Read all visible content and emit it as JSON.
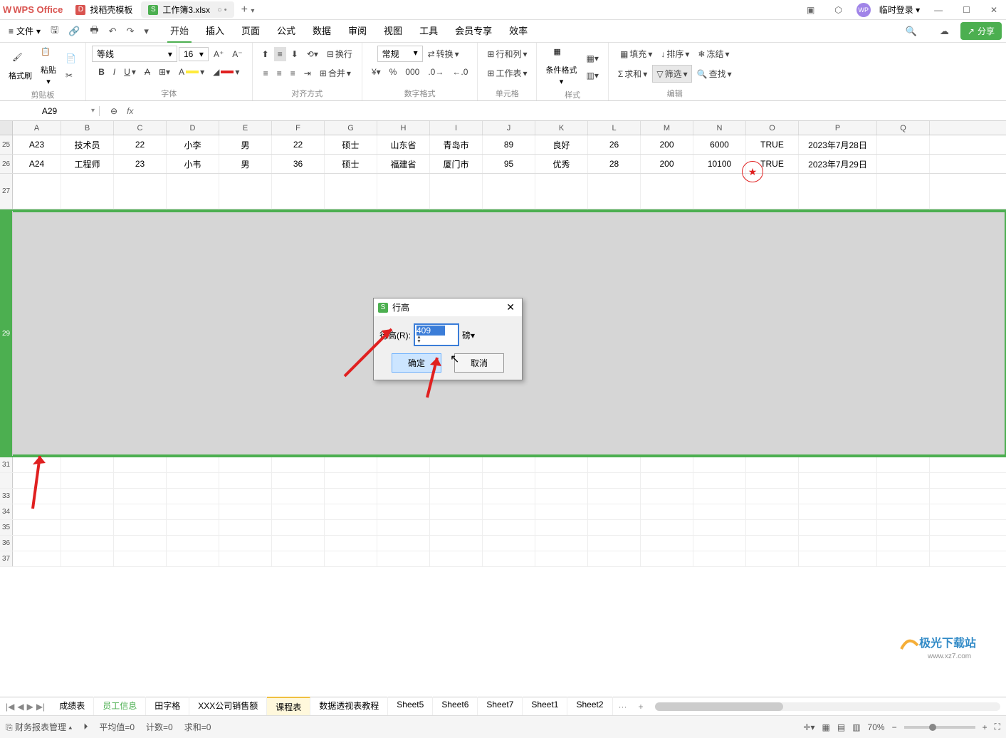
{
  "titlebar": {
    "app_name": "WPS Office",
    "tabs": [
      {
        "label": "找稻壳模板",
        "icon_color": "red"
      },
      {
        "label": "工作簿3.xlsx",
        "icon_color": "green",
        "active": true,
        "extra": "○ •"
      }
    ],
    "login_label": "临时登录",
    "add_glyph": "+",
    "dd_glyph": "▾"
  },
  "menubar": {
    "file_label": "文件",
    "tabs": [
      "开始",
      "插入",
      "页面",
      "公式",
      "数据",
      "审阅",
      "视图",
      "工具",
      "会员专享",
      "效率"
    ],
    "active_tab": "开始",
    "share_label": "分享"
  },
  "ribbon": {
    "clipboard": {
      "brush": "格式刷",
      "paste": "粘贴",
      "group": "剪贴板"
    },
    "font": {
      "name": "等线",
      "size": "16",
      "group": "字体"
    },
    "align": {
      "wrap": "换行",
      "merge": "合并",
      "group": "对齐方式"
    },
    "number": {
      "format": "常规",
      "convert": "转换",
      "group": "数字格式"
    },
    "cells": {
      "rowcol": "行和列",
      "worksheet": "工作表",
      "group": "单元格"
    },
    "styles": {
      "condfmt": "条件格式",
      "group": "样式"
    },
    "edit": {
      "fill": "填充",
      "sort": "排序",
      "freeze": "冻结",
      "sum": "求和",
      "filter": "筛选",
      "find": "查找",
      "group": "编辑"
    }
  },
  "formula_bar": {
    "namebox": "A29",
    "fx": "fx"
  },
  "columns": [
    "A",
    "B",
    "C",
    "D",
    "E",
    "F",
    "G",
    "H",
    "I",
    "J",
    "K",
    "L",
    "M",
    "N",
    "O",
    "P",
    "Q"
  ],
  "col_classes": [
    "cw-a",
    "cw-b",
    "cw-c",
    "cw-d",
    "cw-e",
    "cw-f",
    "cw-g",
    "cw-h",
    "cw-i",
    "cw-j",
    "cw-k",
    "cw-l",
    "cw-m",
    "cw-n",
    "cw-o",
    "cw-p",
    "cw-q"
  ],
  "rows_visible_labels": [
    "25",
    "26",
    "27",
    "",
    "29",
    "",
    "31",
    "",
    "33",
    "34",
    "35",
    "36",
    "37"
  ],
  "data_rows": [
    {
      "n": "25",
      "cells": [
        "A23",
        "技术员",
        "22",
        "小李",
        "男",
        "22",
        "硕士",
        "山东省",
        "青岛市",
        "89",
        "良好",
        "26",
        "200",
        "6000",
        "TRUE",
        "2023年7月28日",
        ""
      ]
    },
    {
      "n": "26",
      "cells": [
        "A24",
        "工程师",
        "23",
        "小韦",
        "男",
        "36",
        "硕士",
        "福建省",
        "厦门市",
        "95",
        "优秀",
        "28",
        "200",
        "10100",
        "TRUE",
        "2023年7月29日",
        ""
      ]
    }
  ],
  "dialog": {
    "title": "行高",
    "label": "行高(R):",
    "value": "409",
    "unit": "磅",
    "ok": "确定",
    "cancel": "取消"
  },
  "sheet_tabs": {
    "nav": [
      "|◀",
      "◀",
      "▶",
      "▶|"
    ],
    "tabs": [
      "成绩表",
      "员工信息",
      "田字格",
      "XXX公司销售额",
      "课程表",
      "数据透视表教程",
      "Sheet5",
      "Sheet6",
      "Sheet7",
      "Sheet1",
      "Sheet2"
    ],
    "active": "课程表",
    "highlighted_green": "员工信息",
    "more": "···",
    "add": "+"
  },
  "statusbar": {
    "left_doc": "财务报表管理",
    "avg": "平均值=0",
    "count": "计数=0",
    "sum": "求和=0",
    "zoom": "70%"
  },
  "watermark": {
    "text": "极光下载站",
    "url": "www.xz7.com"
  }
}
